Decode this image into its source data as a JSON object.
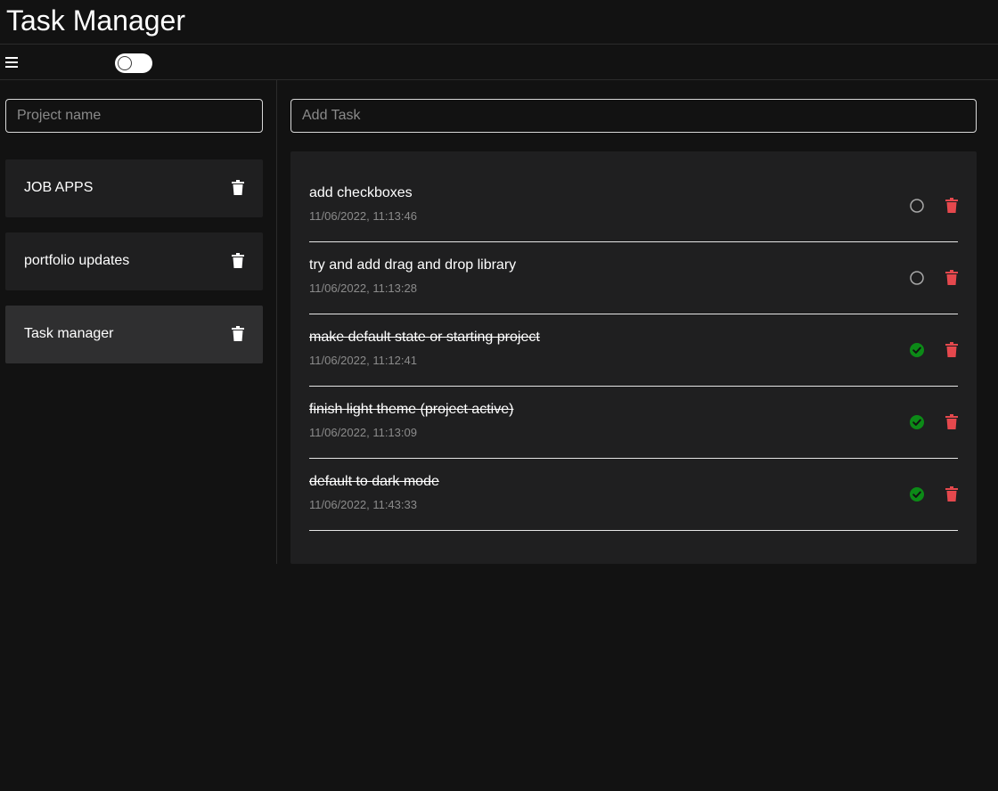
{
  "header": {
    "title": "Task Manager"
  },
  "toolbar": {
    "menu_icon": "hamburger-menu-icon",
    "theme_toggle_on": false
  },
  "sidebar": {
    "project_placeholder": "Project name",
    "projects": [
      {
        "label": "JOB APPS",
        "active": false
      },
      {
        "label": "portfolio updates",
        "active": false
      },
      {
        "label": "Task manager",
        "active": true
      }
    ]
  },
  "main": {
    "task_placeholder": "Add Task",
    "tasks": [
      {
        "title": "add checkboxes",
        "time": "11/06/2022, 11:13:46",
        "done": false
      },
      {
        "title": "try and add drag and drop library",
        "time": "11/06/2022, 11:13:28",
        "done": false
      },
      {
        "title": "make default state or starting project",
        "time": "11/06/2022, 11:12:41",
        "done": true
      },
      {
        "title": "finish light theme (project active)",
        "time": "11/06/2022, 11:13:09",
        "done": true
      },
      {
        "title": "default to dark mode",
        "time": "11/06/2022, 11:43:33",
        "done": true
      }
    ]
  },
  "colors": {
    "background": "#121212",
    "card": "#1f1f20",
    "card_active": "#2f2f30",
    "delete_red": "#e5484d",
    "check_green": "#0c8a17",
    "unchecked_gray": "#a8a8a8"
  }
}
